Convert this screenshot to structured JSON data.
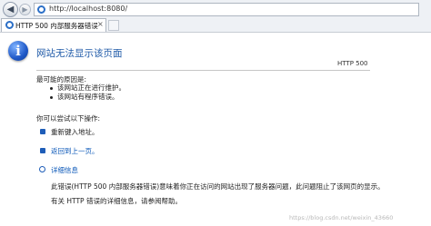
{
  "browser": {
    "url": "http://localhost:8080/",
    "tab_title": "HTTP 500 内部服务器错误",
    "tab_close": "×",
    "back_glyph": "◀",
    "forward_glyph": "▶"
  },
  "page": {
    "info_glyph": "i",
    "title": "网站无法显示该页面",
    "status_code": "HTTP 500",
    "reasons_heading": "最可能的原因是:",
    "reasons": [
      "该网站正在进行维护。",
      "该网站有程序错误。"
    ],
    "actions_heading": "你可以尝试以下操作:",
    "actions": [
      "重新键入地址。",
      "返回到上一页。"
    ],
    "details_toggle": "详细信息",
    "details_text": "此错误(HTTP 500 内部服务器错误)意味着你正在访问的网站出现了服务器问题，此问题阻止了该网页的显示。",
    "details_more": "有关 HTTP 错误的详细信息，请参阅帮助。",
    "watermark": "https://blog.csdn.net/weixin_43660"
  },
  "colors": {
    "title_blue": "#1f5aa8",
    "link_blue": "#0a57b8"
  }
}
